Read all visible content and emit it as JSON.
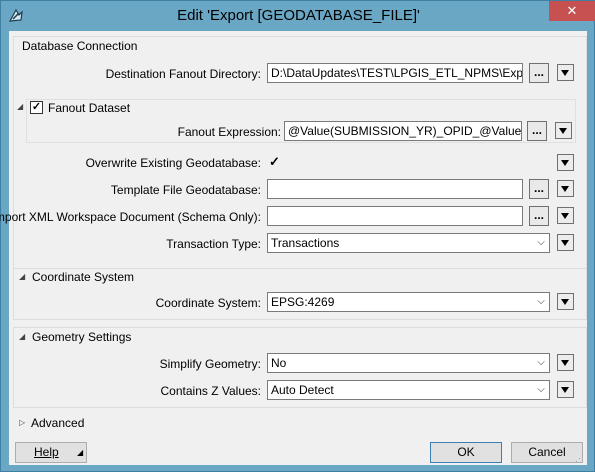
{
  "window": {
    "title": "Edit 'Export [GEODATABASE_FILE]'",
    "close_glyph": "✕"
  },
  "database_connection": {
    "title": "Database Connection",
    "destination_label": "Destination Fanout Directory:",
    "destination_value": "D:\\DataUpdates\\TEST\\LPGIS_ETL_NPMS\\Export",
    "fanout_dataset_label": "Fanout Dataset",
    "fanout_dataset_checked": true,
    "fanout_expression_label": "Fanout Expression:",
    "fanout_expression_value": "@Value(SUBMISSION_YR)_OPID_@Value(OPID)",
    "overwrite_label": "Overwrite Existing Geodatabase:",
    "overwrite_checked": true,
    "template_label": "Template File Geodatabase:",
    "template_value": "",
    "import_xml_label": "Import XML Workspace Document (Schema Only):",
    "import_xml_value": "",
    "transaction_label": "Transaction Type:",
    "transaction_value": "Transactions"
  },
  "coordinate_system": {
    "title": "Coordinate System",
    "label": "Coordinate System:",
    "value": "EPSG:4269"
  },
  "geometry_settings": {
    "title": "Geometry Settings",
    "simplify_label": "Simplify Geometry:",
    "simplify_value": "No",
    "z_label": "Contains Z Values:",
    "z_value": "Auto Detect"
  },
  "advanced": {
    "title": "Advanced"
  },
  "footer": {
    "help_label": "Help",
    "ok_label": "OK",
    "cancel_label": "Cancel"
  },
  "glyphs": {
    "ellipsis": "...",
    "check": "✓",
    "expanded": "◢",
    "collapsed": "▷",
    "combo_down": "⌵"
  },
  "colors": {
    "titlebar": "#6aa7c4",
    "close": "#c75050",
    "panel": "#f0f0f0"
  }
}
